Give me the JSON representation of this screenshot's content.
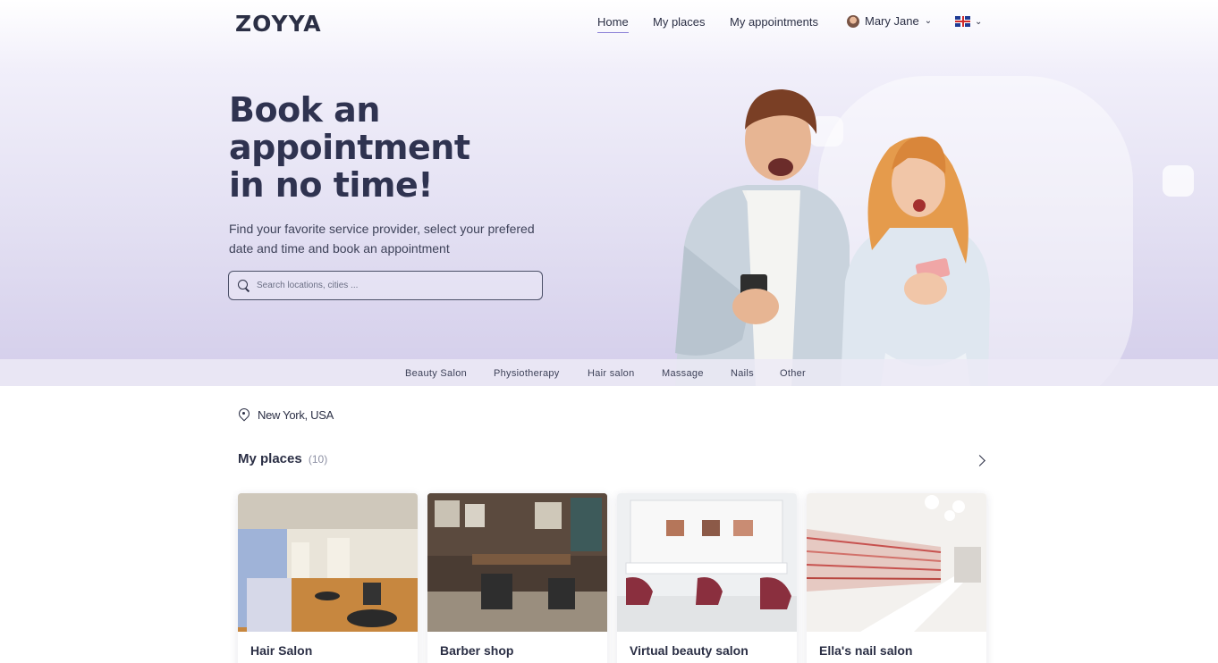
{
  "header": {
    "logo": "ZOYYA",
    "nav": [
      {
        "label": "Home",
        "active": true
      },
      {
        "label": "My places",
        "active": false
      },
      {
        "label": "My appointments",
        "active": false
      }
    ],
    "user_name": "Mary Jane",
    "language_icon": "uk-flag-icon"
  },
  "hero": {
    "headline_line1": "Book an",
    "headline_line2": "appointment",
    "headline_line3": "in no time!",
    "subtext": "Find your favorite service provider, select your prefered date and time and book an appointment",
    "search_placeholder": "Search locations, cities ..."
  },
  "categories": [
    "Beauty Salon",
    "Physiotherapy",
    "Hair salon",
    "Massage",
    "Nails",
    "Other"
  ],
  "location": "New York, USA",
  "places": {
    "title": "My places",
    "count": "(10)",
    "items": [
      {
        "name": "Hair Salon"
      },
      {
        "name": "Barber shop"
      },
      {
        "name": "Virtual beauty salon"
      },
      {
        "name": "Ella's nail salon"
      }
    ]
  },
  "colors": {
    "primary_text": "#2b2f45",
    "accent": "#8a7fd6",
    "hero_gradient_bottom": "#d3cdea"
  }
}
